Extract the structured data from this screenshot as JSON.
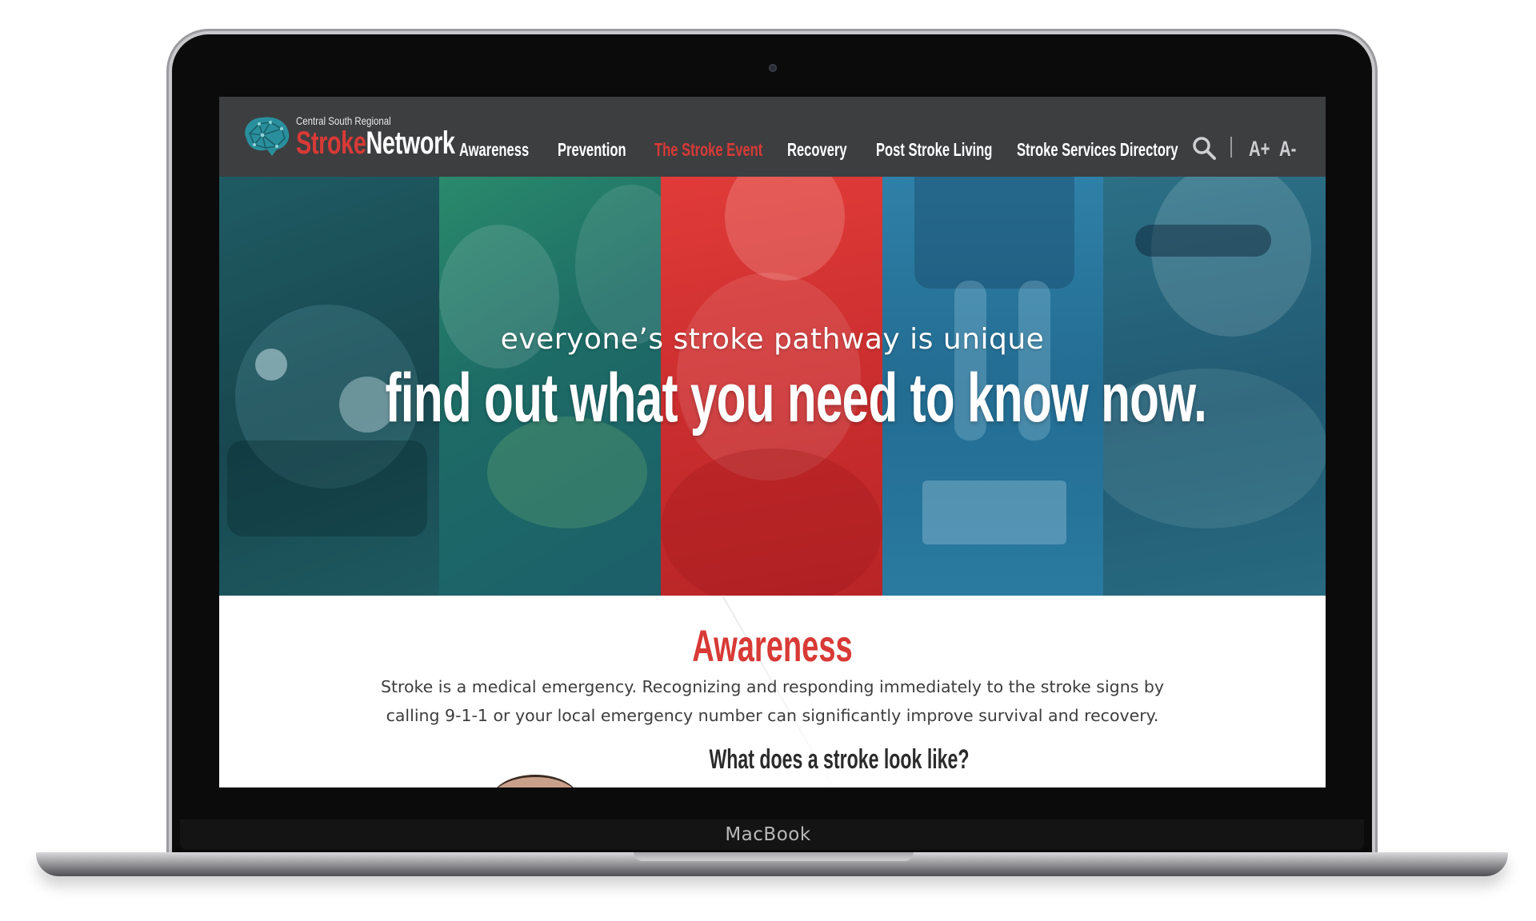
{
  "device": {
    "brand_label": "MacBook"
  },
  "logo": {
    "small_text": "Central South Regional",
    "big_part1": "Stroke",
    "big_part2": "Network"
  },
  "nav": {
    "items": [
      {
        "label": "Awareness",
        "active": false
      },
      {
        "label": "Prevention",
        "active": false
      },
      {
        "label": "The Stroke Event",
        "active": true
      },
      {
        "label": "Recovery",
        "active": false
      },
      {
        "label": "Post Stroke Living",
        "active": false
      },
      {
        "label": "Stroke Services Directory",
        "active": false
      }
    ],
    "tools": {
      "search_icon": "search-icon",
      "font_increase": "A+",
      "font_decrease": "A-"
    }
  },
  "hero": {
    "subtitle": "everyone’s stroke pathway is unique",
    "title": "find out what you need to know now.",
    "panel_colors": [
      "#1f5b63",
      "#2a8a6b",
      "#e03b39",
      "#2f80a8",
      "#2c7086"
    ]
  },
  "content": {
    "section_title": "Awareness",
    "body": "Stroke is a medical emergency. Recognizing and responding immediately to the stroke signs by calling 9-1-1 or your local emergency number can significantly improve survival and recovery.",
    "sub_heading": "What does a stroke look like?"
  },
  "colors": {
    "brand_red": "#d83a36",
    "nav_bg": "#3d3e40",
    "logo_teal": "#2a8f9c"
  }
}
